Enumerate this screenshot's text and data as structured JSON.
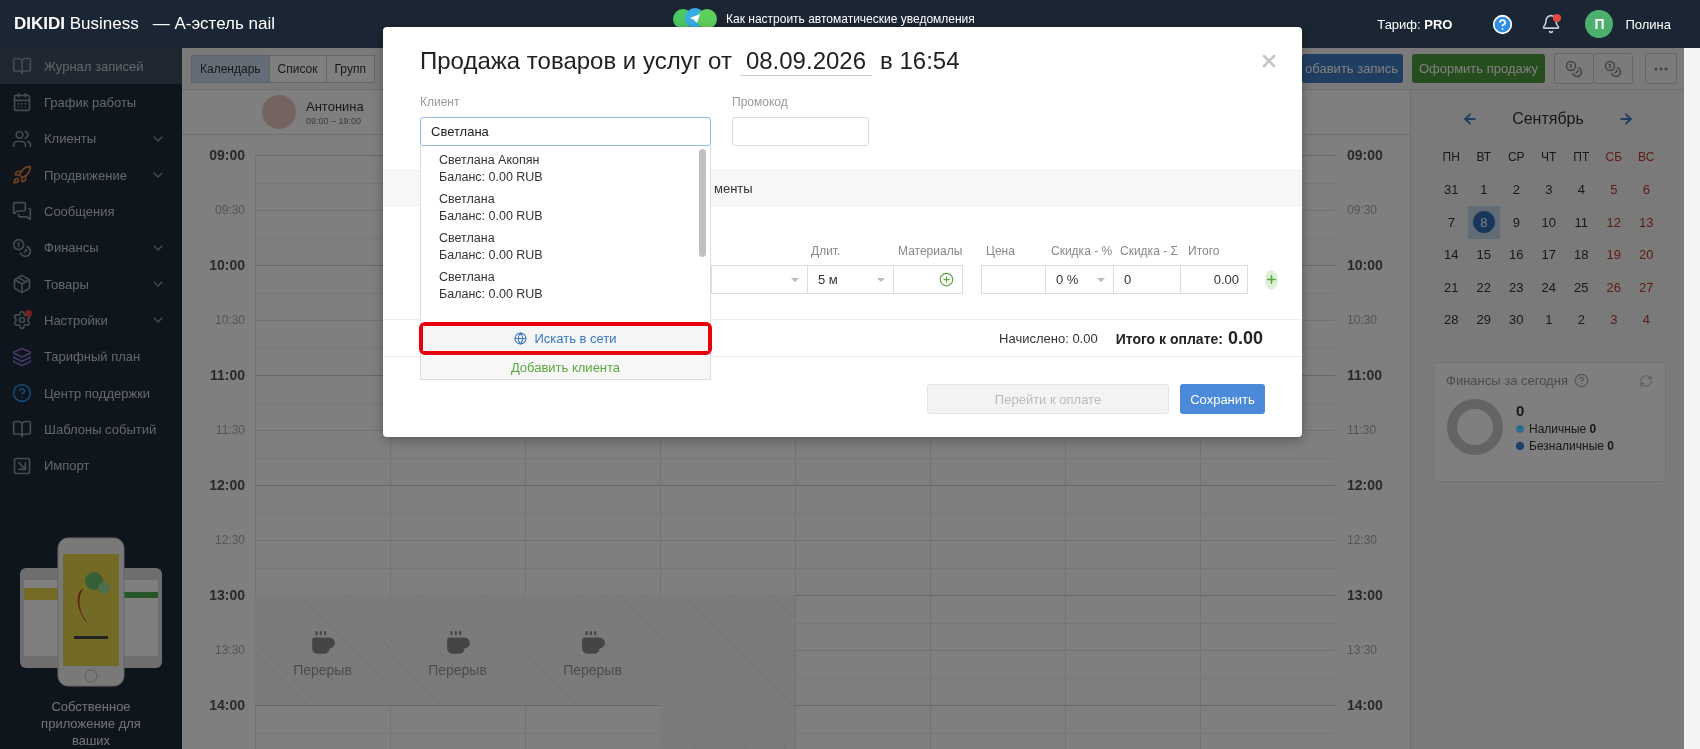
{
  "top_bar": {
    "brand": "**DIKIDI** Business",
    "account": "— А-эстель nail",
    "notice": "Как настроить автоматические уведомления",
    "plan": "Тариф: **PRO**",
    "has_notification": true,
    "user_initial": "П",
    "user_name": "Полина"
  },
  "sidebar": {
    "items": [
      {
        "label": "Журнал записей",
        "selected": true,
        "expandable": false,
        "alert": false
      },
      {
        "label": "График работы",
        "selected": false,
        "expandable": false,
        "alert": false
      },
      {
        "label": "Клиенты",
        "selected": false,
        "expandable": true,
        "alert": false
      },
      {
        "label": "Продвижение",
        "selected": false,
        "expandable": true,
        "alert": false
      },
      {
        "label": "Сообщения",
        "selected": false,
        "expandable": false,
        "alert": false
      },
      {
        "label": "Финансы",
        "selected": false,
        "expandable": true,
        "alert": false
      },
      {
        "label": "Товары",
        "selected": false,
        "expandable": true,
        "alert": false
      },
      {
        "label": "Настройки",
        "selected": false,
        "expandable": true,
        "alert": true
      },
      {
        "label": "Тарифный план",
        "selected": false,
        "expandable": false,
        "alert": false
      },
      {
        "label": "Центр поддержки",
        "selected": false,
        "expandable": false,
        "alert": false
      },
      {
        "label": "Шаблоны событий",
        "selected": false,
        "expandable": false,
        "alert": false
      },
      {
        "label": "Импорт",
        "selected": false,
        "expandable": false,
        "alert": false
      }
    ],
    "promo_text": "Собственное приложение для ваших"
  },
  "toolbar": {
    "view_tabs": [
      {
        "label": "Календарь",
        "selected": true
      },
      {
        "label": "Список",
        "selected": false
      },
      {
        "label": "Групп",
        "selected": false
      }
    ],
    "add_button": "обавить запись",
    "sale_button": "Оформить продажу"
  },
  "calendar": {
    "staff": [
      {
        "name": "Антонина",
        "hours": "09:00 – 19:00"
      }
    ],
    "times_left": [
      {
        "label": "09:00",
        "kind": "hour"
      },
      {
        "label": "09:30",
        "kind": "half"
      },
      {
        "label": "10:00",
        "kind": "hour"
      },
      {
        "label": "10:30",
        "kind": "half"
      },
      {
        "label": "11:00",
        "kind": "hour"
      },
      {
        "label": "11:30",
        "kind": "half"
      },
      {
        "label": "12:00",
        "kind": "hour"
      },
      {
        "label": "12:30",
        "kind": "half"
      },
      {
        "label": "13:00",
        "kind": "hour"
      },
      {
        "label": "13:30",
        "kind": "half"
      },
      {
        "label": "14:00",
        "kind": "hour"
      }
    ],
    "times_right": [
      {
        "label": "09:00",
        "kind": "hour"
      },
      {
        "label": "09:30",
        "kind": "half"
      },
      {
        "label": "10:00",
        "kind": "hour"
      },
      {
        "label": "10:30",
        "kind": "half"
      },
      {
        "label": "11:00",
        "kind": "hour"
      },
      {
        "label": "11:30",
        "kind": "half"
      },
      {
        "label": "12:00",
        "kind": "hour"
      },
      {
        "label": "12:30",
        "kind": "half"
      },
      {
        "label": "13:00",
        "kind": "hour"
      },
      {
        "label": "13:30",
        "kind": "half"
      },
      {
        "label": "14:00",
        "kind": "hour"
      }
    ],
    "breaks": [
      {
        "label": "Перерыв"
      },
      {
        "label": "Перерыв"
      },
      {
        "label": "Перерыв"
      }
    ]
  },
  "mini_calendar": {
    "month": "Сентябрь",
    "weekdays": [
      {
        "label": "ПН",
        "weekend": false
      },
      {
        "label": "ВТ",
        "weekend": false
      },
      {
        "label": "СР",
        "weekend": false
      },
      {
        "label": "ЧТ",
        "weekend": false
      },
      {
        "label": "ПТ",
        "weekend": false
      },
      {
        "label": "СБ",
        "weekend": true
      },
      {
        "label": "ВС",
        "weekend": true
      }
    ],
    "weeks": [
      [
        {
          "day": "31",
          "selected": false
        },
        {
          "day": "1",
          "selected": false
        },
        {
          "day": "2",
          "selected": false
        },
        {
          "day": "3",
          "selected": false
        },
        {
          "day": "4",
          "selected": false
        },
        {
          "day": "5",
          "selected": false
        },
        {
          "day": "6",
          "selected": false
        }
      ],
      [
        {
          "day": "7",
          "selected": false
        },
        {
          "day": "8",
          "selected": true
        },
        {
          "day": "9",
          "selected": false
        },
        {
          "day": "10",
          "selected": false
        },
        {
          "day": "11",
          "selected": false
        },
        {
          "day": "12",
          "selected": false
        },
        {
          "day": "13",
          "selected": false
        }
      ],
      [
        {
          "day": "14",
          "selected": false
        },
        {
          "day": "15",
          "selected": false
        },
        {
          "day": "16",
          "selected": false
        },
        {
          "day": "17",
          "selected": false
        },
        {
          "day": "18",
          "selected": false
        },
        {
          "day": "19",
          "selected": false
        },
        {
          "day": "20",
          "selected": false
        }
      ],
      [
        {
          "day": "21",
          "selected": false
        },
        {
          "day": "22",
          "selected": false
        },
        {
          "day": "23",
          "selected": false
        },
        {
          "day": "24",
          "selected": false
        },
        {
          "day": "25",
          "selected": false
        },
        {
          "day": "26",
          "selected": false
        },
        {
          "day": "27",
          "selected": false
        }
      ],
      [
        {
          "day": "28",
          "selected": false
        },
        {
          "day": "29",
          "selected": false
        },
        {
          "day": "30",
          "selected": false
        },
        {
          "day": "1",
          "selected": false
        },
        {
          "day": "2",
          "selected": false
        },
        {
          "day": "3",
          "selected": false
        },
        {
          "day": "4",
          "selected": false
        }
      ]
    ]
  },
  "finance": {
    "title": "Финансы за сегодня",
    "total": "0",
    "legend": [
      {
        "label": "Наличные",
        "value": "0",
        "color": "#2e6f8c"
      },
      {
        "label": "Безналичные",
        "value": "0",
        "color": "#1c3f6b"
      }
    ]
  },
  "modal": {
    "title": "Продажа товаров и услуг от",
    "date": "08.09.2026",
    "time": "в 16:54",
    "client_label": "Клиент",
    "client_value": "Светлана",
    "promo_label": "Промокод",
    "tab_fragment": "менты",
    "columns": [
      "Длит.",
      "Материалы",
      "Цена",
      "Скидка - %",
      "Скидка - Σ",
      "Итого"
    ],
    "row": {
      "duration": "5 м",
      "discount_pct": "0 %",
      "discount_sum": "0",
      "total": "0.00"
    },
    "accrued": "Начислено: 0.00",
    "to_pay_label": "Итого к оплате:",
    "to_pay_value": "0.00",
    "pay_button": {
      "label": "Перейти к оплате",
      "disabled": true
    },
    "save_button": "Сохранить",
    "suggestions": [
      {
        "name": "Светлана Акопян",
        "balance": "Баланс: 0.00 RUB"
      },
      {
        "name": "Светлана",
        "balance": "Баланс: 0.00 RUB"
      },
      {
        "name": "Светлана",
        "balance": "Баланс: 0.00 RUB"
      },
      {
        "name": "Светлана",
        "balance": "Баланс: 0.00 RUB"
      }
    ],
    "search_web": "Искать в сети",
    "add_client": "Добавить клиента"
  }
}
